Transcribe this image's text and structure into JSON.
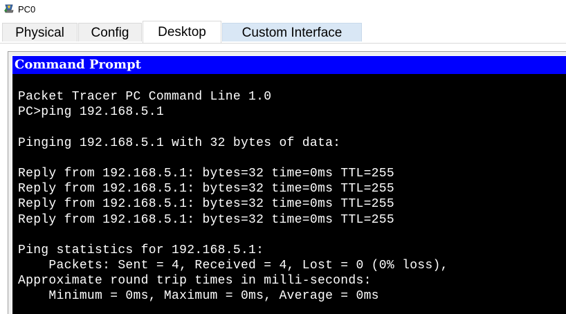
{
  "window": {
    "title": "PC0",
    "icon": "packet-tracer-pc-icon"
  },
  "tabs": [
    {
      "label": "Physical",
      "active": false
    },
    {
      "label": "Config",
      "active": false
    },
    {
      "label": "Desktop",
      "active": true
    },
    {
      "label": "Custom Interface",
      "active": false
    }
  ],
  "command_prompt": {
    "title": "Command Prompt",
    "title_bar_color": "#0000ff",
    "background_color": "#000000",
    "text_color": "#ffffff",
    "lines": [
      "Packet Tracer PC Command Line 1.0",
      "PC>ping 192.168.5.1",
      "",
      "Pinging 192.168.5.1 with 32 bytes of data:",
      "",
      "Reply from 192.168.5.1: bytes=32 time=0ms TTL=255",
      "Reply from 192.168.5.1: bytes=32 time=0ms TTL=255",
      "Reply from 192.168.5.1: bytes=32 time=0ms TTL=255",
      "Reply from 192.168.5.1: bytes=32 time=0ms TTL=255",
      "",
      "Ping statistics for 192.168.5.1:",
      "    Packets: Sent = 4, Received = 4, Lost = 0 (0% loss),",
      "Approximate round trip times in milli-seconds:",
      "    Minimum = 0ms, Maximum = 0ms, Average = 0ms"
    ]
  }
}
